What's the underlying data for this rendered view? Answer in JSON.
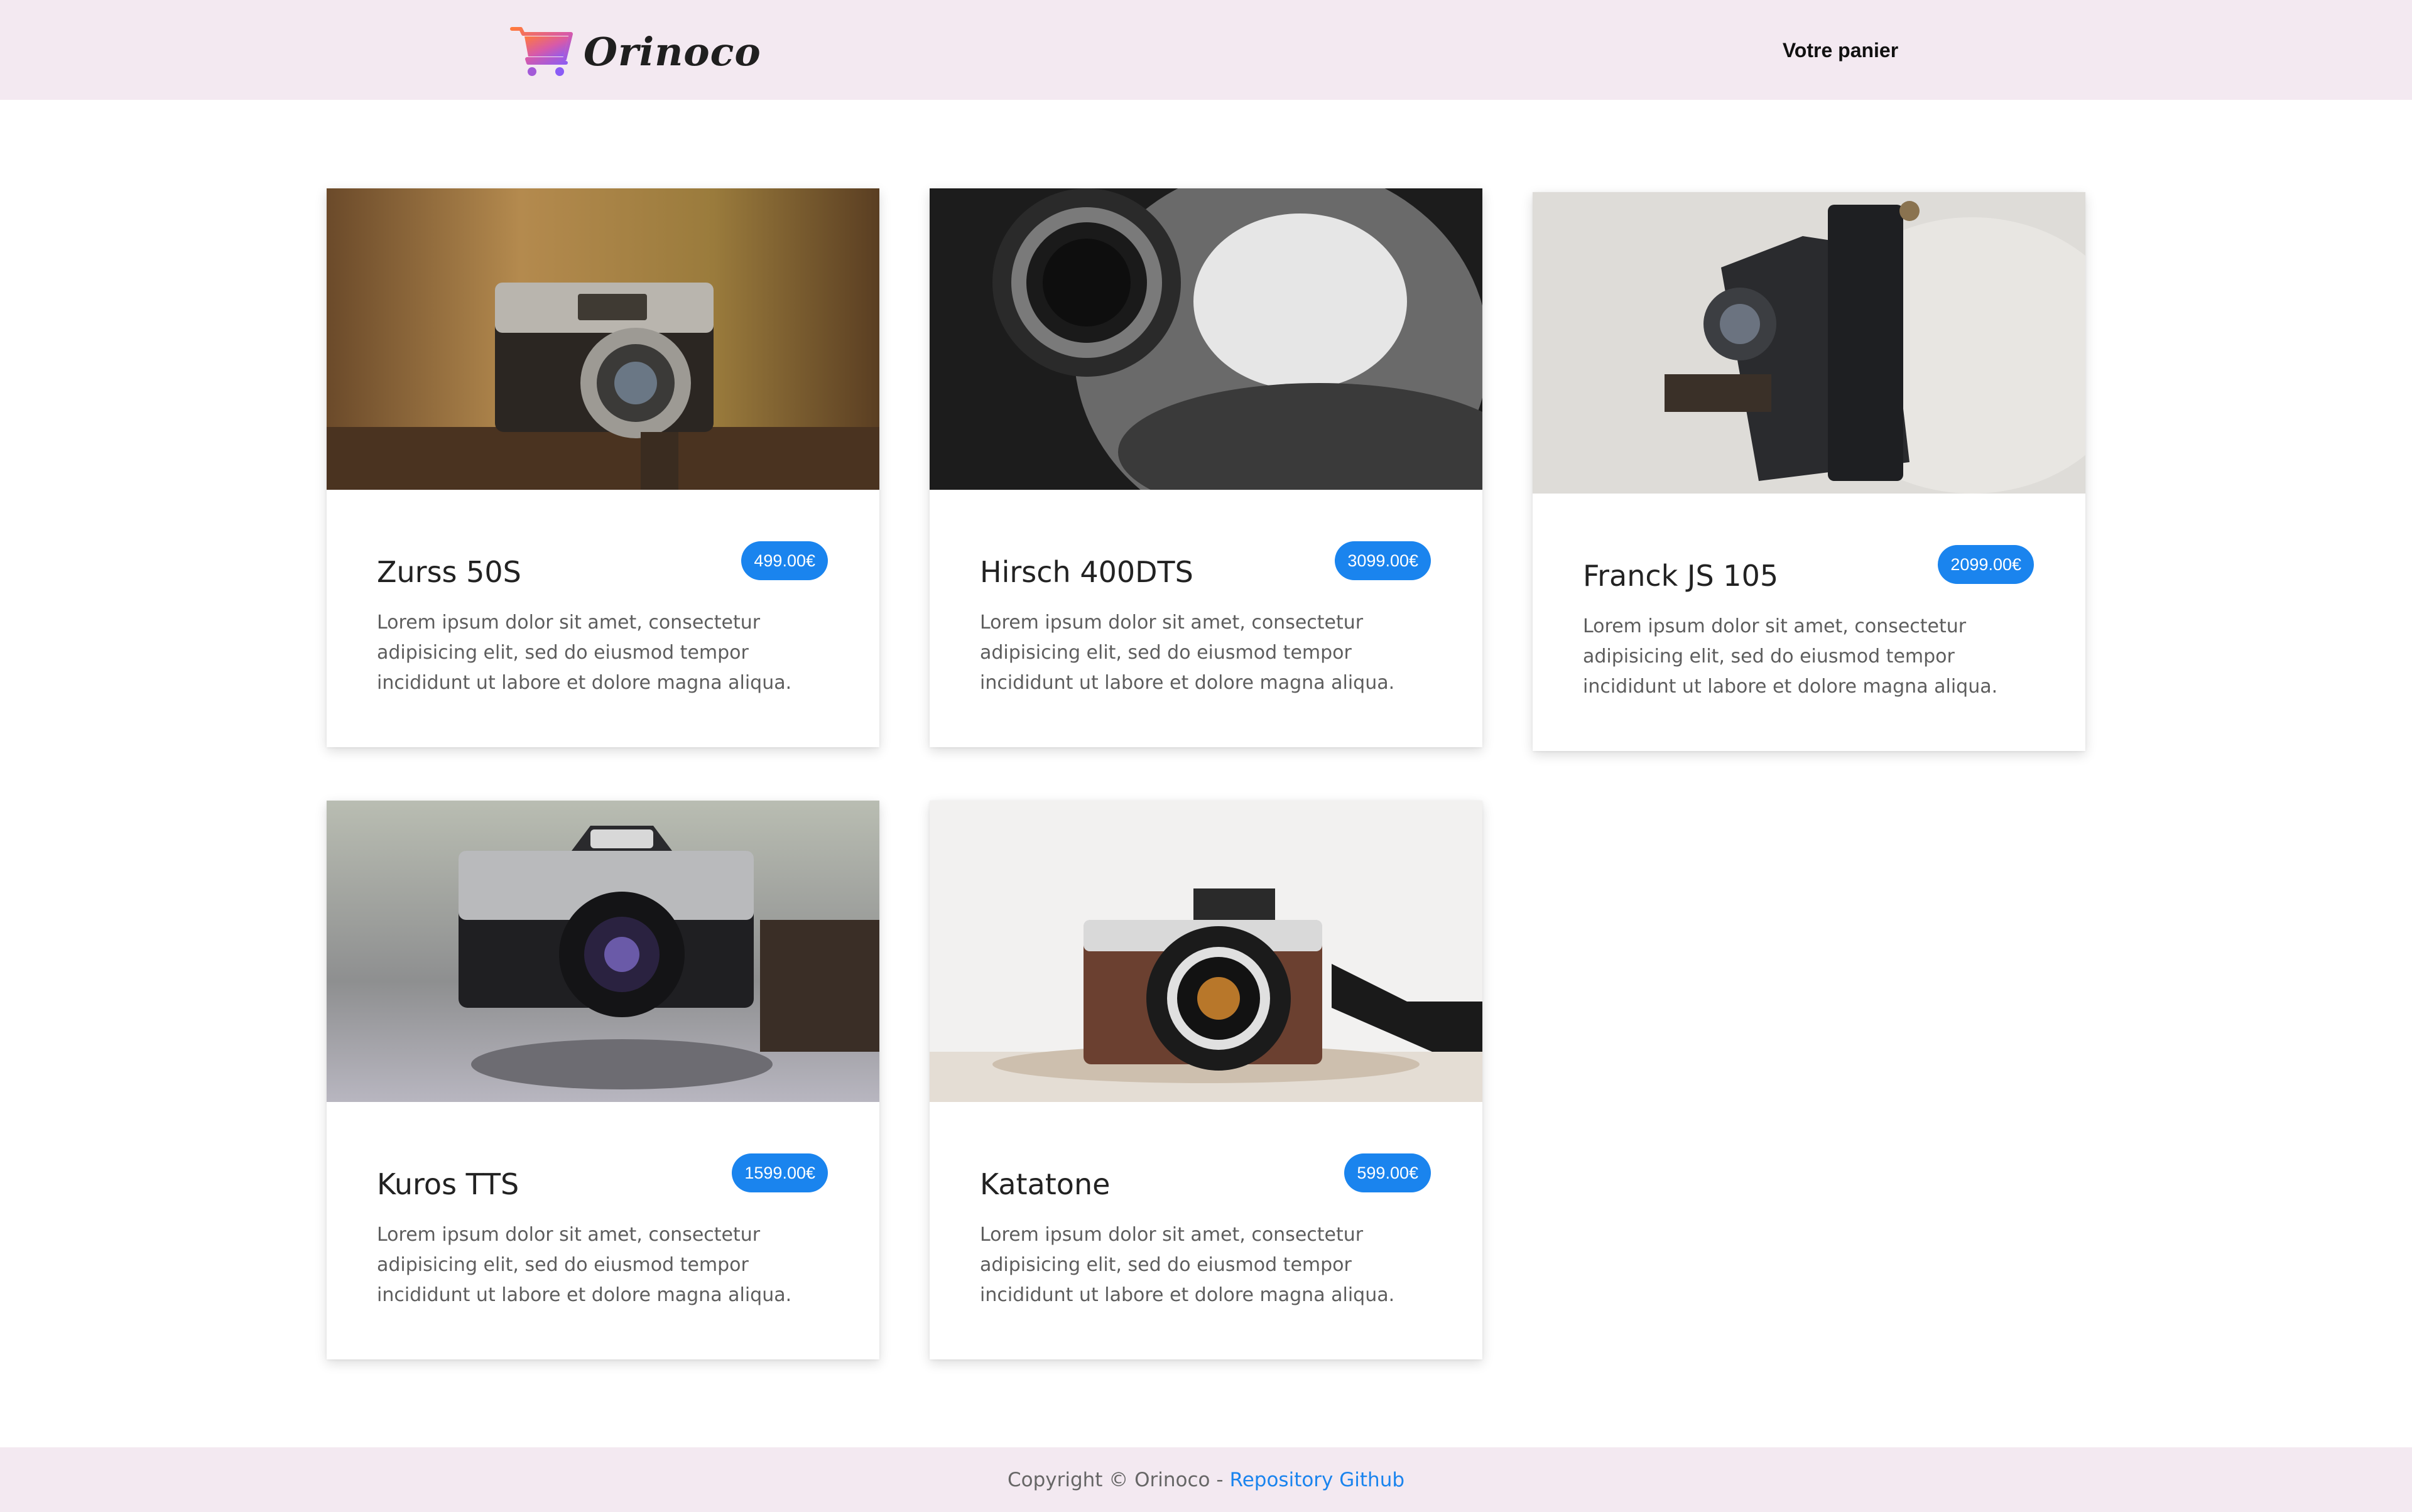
{
  "header": {
    "brand": "Orinoco",
    "brand_icon": "shopping-cart-icon",
    "cart_link": "Votre panier"
  },
  "products": [
    {
      "name": "Zurss 50S",
      "price": "499.00€",
      "description": "Lorem ipsum dolor sit amet, consectetur adipisicing elit, sed do eiusmod tempor incididunt ut labore et dolore magna aliqua."
    },
    {
      "name": "Hirsch 400DTS",
      "price": "3099.00€",
      "description": "Lorem ipsum dolor sit amet, consectetur adipisicing elit, sed do eiusmod tempor incididunt ut labore et dolore magna aliqua."
    },
    {
      "name": "Franck JS 105",
      "price": "2099.00€",
      "description": "Lorem ipsum dolor sit amet, consectetur adipisicing elit, sed do eiusmod tempor incididunt ut labore et dolore magna aliqua."
    },
    {
      "name": "Kuros TTS",
      "price": "1599.00€",
      "description": "Lorem ipsum dolor sit amet, consectetur adipisicing elit, sed do eiusmod tempor incididunt ut labore et dolore magna aliqua."
    },
    {
      "name": "Katatone",
      "price": "599.00€",
      "description": "Lorem ipsum dolor sit amet, consectetur adipisicing elit, sed do eiusmod tempor incididunt ut labore et dolore magna aliqua."
    }
  ],
  "footer": {
    "copyright": "Copyright © Orinoco - ",
    "repo_link": "Repository Github"
  },
  "colors": {
    "navbar_bg": "#f3e9f1",
    "price_badge": "#1a84ee",
    "link": "#1a84ee"
  }
}
